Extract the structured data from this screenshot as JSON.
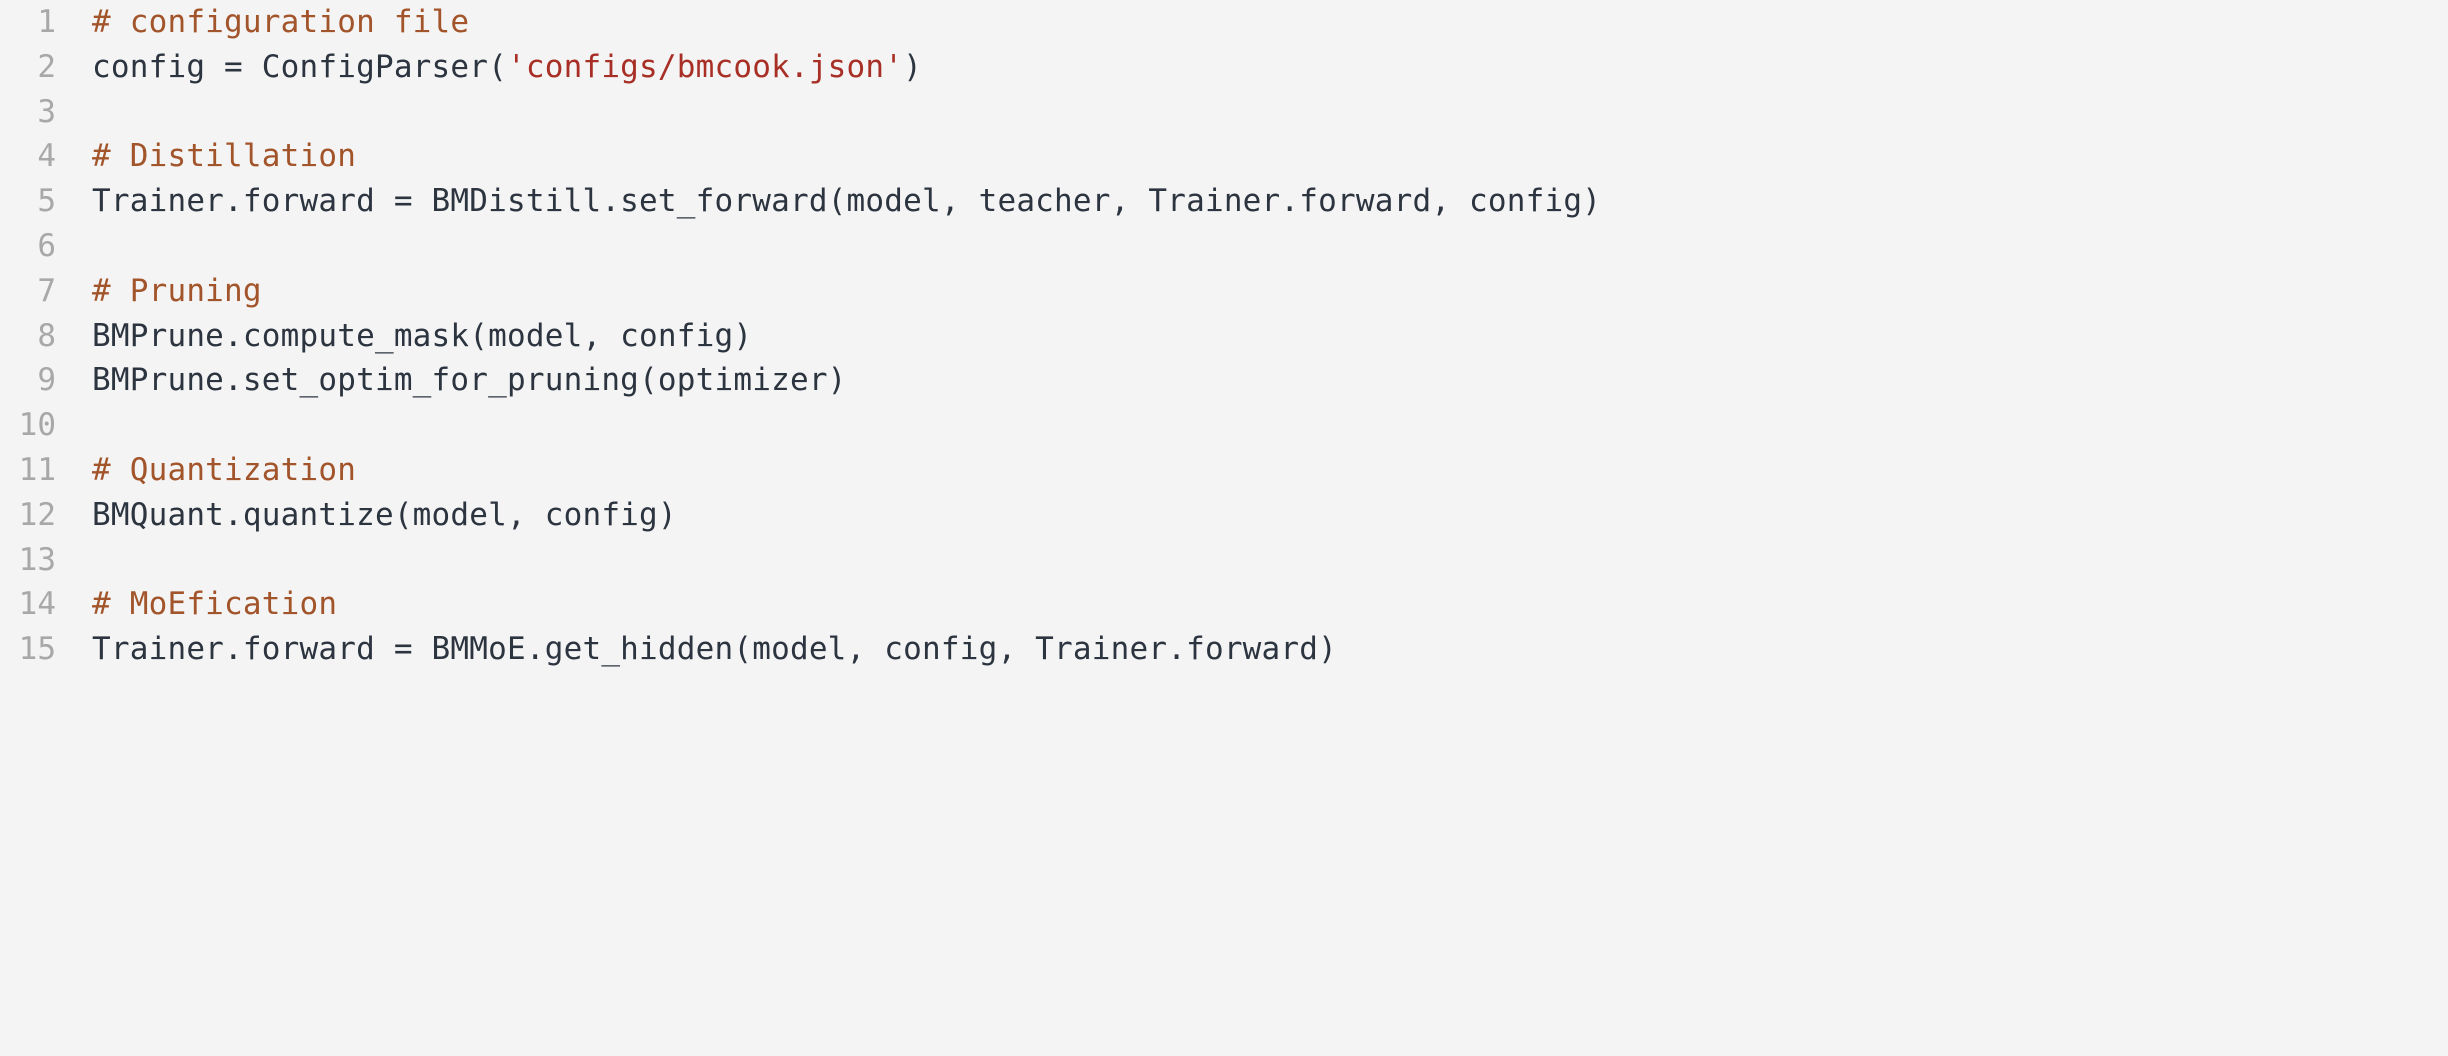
{
  "code_block": {
    "language": "python",
    "background_color": "#f4f4f4",
    "colors": {
      "line_number": "#a8a8a8",
      "comment": "#a2542a",
      "string": "#a82f26",
      "plain": "#2c3440"
    },
    "lines": [
      {
        "number": "1",
        "text": "# configuration file",
        "tokens": [
          {
            "t": "# configuration file",
            "k": "comment"
          }
        ]
      },
      {
        "number": "2",
        "text": "config = ConfigParser('configs/bmcook.json')",
        "tokens": [
          {
            "t": "config = ConfigParser(",
            "k": "plain"
          },
          {
            "t": "'configs/bmcook.json'",
            "k": "string"
          },
          {
            "t": ")",
            "k": "plain"
          }
        ]
      },
      {
        "number": "3",
        "text": "",
        "tokens": []
      },
      {
        "number": "4",
        "text": "# Distillation",
        "tokens": [
          {
            "t": "# Distillation",
            "k": "comment"
          }
        ]
      },
      {
        "number": "5",
        "text": "Trainer.forward = BMDistill.set_forward(model, teacher, Trainer.forward, config)",
        "tokens": [
          {
            "t": "Trainer.forward = BMDistill.set_forward(model, teacher, Trainer.forward, config)",
            "k": "plain"
          }
        ]
      },
      {
        "number": "6",
        "text": "",
        "tokens": []
      },
      {
        "number": "7",
        "text": "# Pruning",
        "tokens": [
          {
            "t": "# Pruning",
            "k": "comment"
          }
        ]
      },
      {
        "number": "8",
        "text": "BMPrune.compute_mask(model, config)",
        "tokens": [
          {
            "t": "BMPrune.compute_mask(model, config)",
            "k": "plain"
          }
        ]
      },
      {
        "number": "9",
        "text": "BMPrune.set_optim_for_pruning(optimizer)",
        "tokens": [
          {
            "t": "BMPrune.set_optim_for_pruning(optimizer)",
            "k": "plain"
          }
        ]
      },
      {
        "number": "10",
        "text": "",
        "tokens": []
      },
      {
        "number": "11",
        "text": "# Quantization",
        "tokens": [
          {
            "t": "# Quantization",
            "k": "comment"
          }
        ]
      },
      {
        "number": "12",
        "text": "BMQuant.quantize(model, config)",
        "tokens": [
          {
            "t": "BMQuant.quantize(model, config)",
            "k": "plain"
          }
        ]
      },
      {
        "number": "13",
        "text": "",
        "tokens": []
      },
      {
        "number": "14",
        "text": "# MoEfication",
        "tokens": [
          {
            "t": "# MoEfication",
            "k": "comment"
          }
        ]
      },
      {
        "number": "15",
        "text": "Trainer.forward = BMMoE.get_hidden(model, config, Trainer.forward)",
        "tokens": [
          {
            "t": "Trainer.forward = BMMoE.get_hidden(model, config, Trainer.forward)",
            "k": "plain"
          }
        ]
      }
    ]
  }
}
